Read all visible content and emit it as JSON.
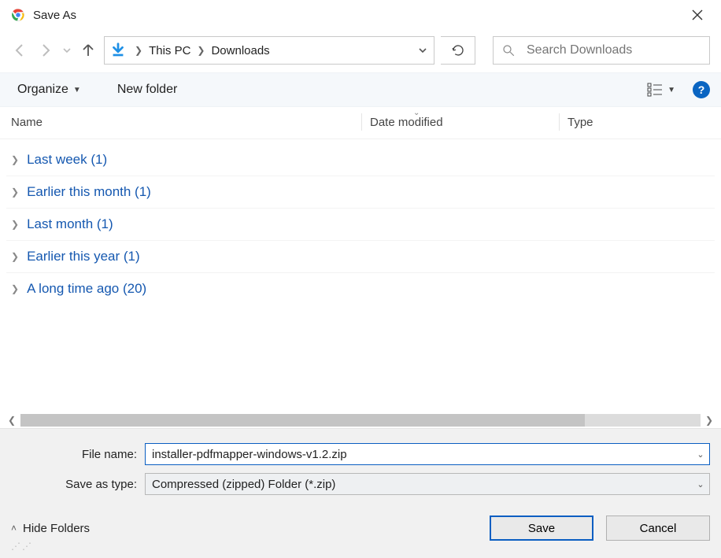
{
  "window": {
    "title": "Save As"
  },
  "nav": {
    "breadcrumb": [
      "This PC",
      "Downloads"
    ],
    "search_placeholder": "Search Downloads"
  },
  "toolbar": {
    "organize": "Organize",
    "new_folder": "New folder"
  },
  "columns": {
    "name": "Name",
    "date": "Date modified",
    "type": "Type"
  },
  "groups": [
    {
      "label": "Last week (1)"
    },
    {
      "label": "Earlier this month (1)"
    },
    {
      "label": "Last month (1)"
    },
    {
      "label": "Earlier this year (1)"
    },
    {
      "label": "A long time ago (20)"
    }
  ],
  "form": {
    "filename_label": "File name:",
    "filename_value": "installer-pdfmapper-windows-v1.2.zip",
    "type_label": "Save as type:",
    "type_value": "Compressed (zipped) Folder (*.zip)"
  },
  "footer": {
    "hide_folders": "Hide Folders",
    "save": "Save",
    "cancel": "Cancel"
  }
}
